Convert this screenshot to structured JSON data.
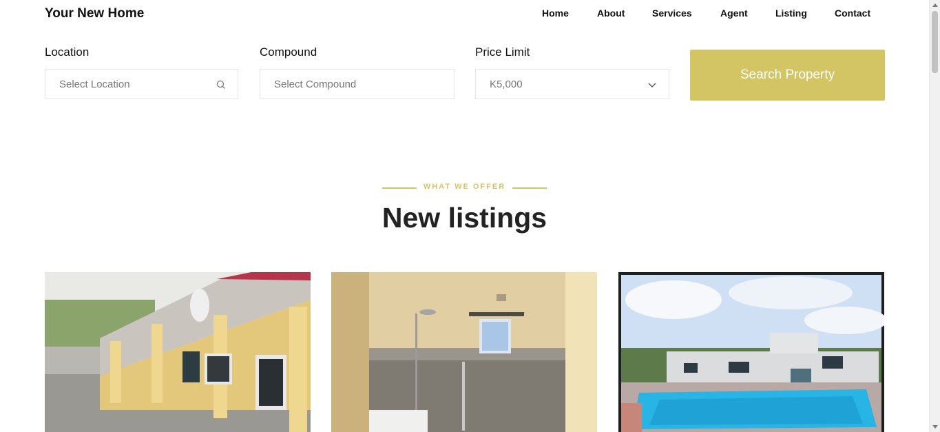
{
  "brand": "Your New Home",
  "nav": [
    "Home",
    "About",
    "Services",
    "Agent",
    "Listing",
    "Contact"
  ],
  "search": {
    "location": {
      "label": "Location",
      "placeholder": "Select Location",
      "icon": "search-icon"
    },
    "compound": {
      "label": "Compound",
      "placeholder": "Select Compound"
    },
    "price": {
      "label": "Price Limit",
      "value": "K5,000",
      "icon": "chevron-down-icon"
    },
    "button": "Search Property"
  },
  "section": {
    "eyebrow": "WHAT WE OFFER",
    "title": "New listings"
  },
  "colors": {
    "accent": "#d4c564",
    "text": "#111111"
  }
}
